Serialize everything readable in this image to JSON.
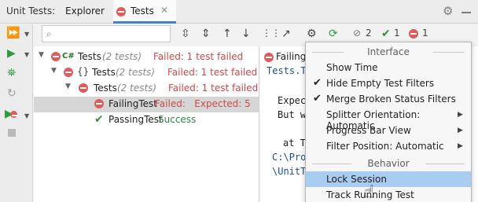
{
  "window": {
    "title": "Unit Tests:"
  },
  "tabs": [
    {
      "label": "Explorer"
    },
    {
      "label": "Tests"
    }
  ],
  "toolbar": {
    "search_placeholder": "",
    "ignored_count": "2",
    "passed_count": "1",
    "failed_count": "1"
  },
  "tree": {
    "rows": [
      {
        "name": "Tests",
        "count": "(2 tests)",
        "status": "Failed: 1 test failed",
        "kind": "project"
      },
      {
        "name": "Tests",
        "count": "(2 tests)",
        "status": "Failed: 1 test failed",
        "kind": "namespace"
      },
      {
        "name": "Tests",
        "count": "(2 tests)",
        "status": "Failed: 1 test failed",
        "kind": "class"
      },
      {
        "name": "FailingTest",
        "count": "",
        "status": "Failed:   Expected: 5",
        "kind": "test-failed"
      },
      {
        "name": "PassingTest",
        "count": "",
        "status": "Success",
        "kind": "test-passed"
      }
    ]
  },
  "output": {
    "header": "Failing",
    "lines": [
      "Tests.T",
      "Expec",
      "But w",
      "at T",
      "C:\\Pro",
      "\\UnitT"
    ]
  },
  "menu": {
    "section_interface": "Interface",
    "section_behavior": "Behavior",
    "items": [
      {
        "label": "Show Time",
        "checked": false,
        "submenu": false
      },
      {
        "label": "Hide Empty Test Filters",
        "checked": true,
        "submenu": false
      },
      {
        "label": "Merge Broken Status Filters",
        "checked": true,
        "submenu": false
      },
      {
        "label": "Splitter Orientation: Automatic",
        "checked": false,
        "submenu": true
      },
      {
        "label": "Progress Bar View",
        "checked": false,
        "submenu": true
      },
      {
        "label": "Filter Position: Automatic",
        "checked": false,
        "submenu": true
      }
    ],
    "behavior_items": [
      {
        "label": "Lock Session",
        "highlighted": true
      },
      {
        "label": "Track Running Test",
        "highlighted": false
      }
    ]
  },
  "colors": {
    "accent": "#4083c9",
    "fail": "#d04848",
    "success": "#2b8a3e",
    "highlight": "#a9ccf1"
  },
  "icons": [
    "run-all-icon",
    "run-icon",
    "debug-icon",
    "rerun-icon",
    "stop-icon",
    "search-icon",
    "gear-icon",
    "hand-cursor-icon"
  ]
}
